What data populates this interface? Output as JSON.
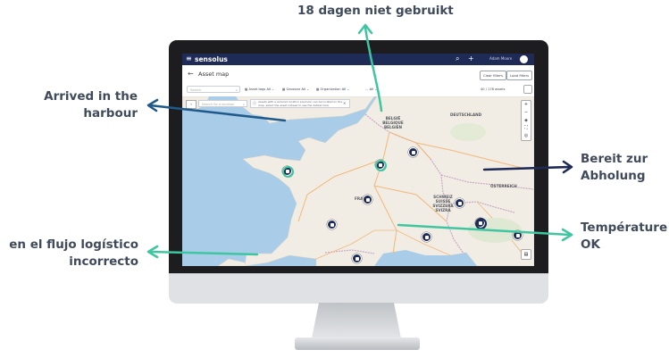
{
  "callouts": {
    "top": "18 dagen niet gebruikt",
    "left_top_line1": "Arrived in the",
    "left_top_line2": "harbour",
    "left_bottom_line1": "en el flujo logístico",
    "left_bottom_line2": "incorrecto",
    "right_top_line1": "Bereit zur",
    "right_top_line2": "Abholung",
    "right_bottom_line1": "Température",
    "right_bottom_line2": "OK"
  },
  "colors": {
    "callout_text": "#3f4a5a",
    "arrow_green": "#3fc6a0",
    "arrow_blue": "#1f5a8a",
    "arrow_navy": "#1f2b57",
    "app_header": "#1f2b57",
    "sea": "#a9cde8",
    "land": "#f1ede4"
  },
  "app": {
    "menu_icon": "hamburger-icon",
    "logo": "sensolus",
    "header_icons": [
      "search-icon",
      "plus-icon"
    ],
    "user_name": "Adam Moore",
    "page_title": "Asset map",
    "back_icon": "arrow-left-icon",
    "buttons": {
      "clear_filters": "Clear filters",
      "load_filters": "Load filters"
    },
    "filters": {
      "search_placeholder": "Search",
      "chip1_label": "Asset tags",
      "chip1_value": "All",
      "chip2_label": "Geozone",
      "chip2_value": "All",
      "chip3_label": "Organization",
      "chip3_value": "All",
      "chip4_label": "...",
      "chip4_value": "All",
      "asset_count": "40 / 178 assets"
    },
    "map": {
      "search_placeholder": "Search for a location",
      "info_text": "Assets with a reduced location precision can be located on the map, select the asset instead to see the details here.",
      "zoom_in": "+",
      "zoom_out": "−",
      "countries": {
        "belgium": [
          "BELGIË",
          "BELGIQUE",
          "BELGIEN"
        ],
        "germany": "DEUTSCHLAND",
        "france": "FRANCE",
        "switzerland": [
          "SCHWEIZ",
          "SUISSE",
          "SVIZZERA",
          "SVIZRA"
        ],
        "austria": "ÖSTERREICH"
      }
    }
  }
}
